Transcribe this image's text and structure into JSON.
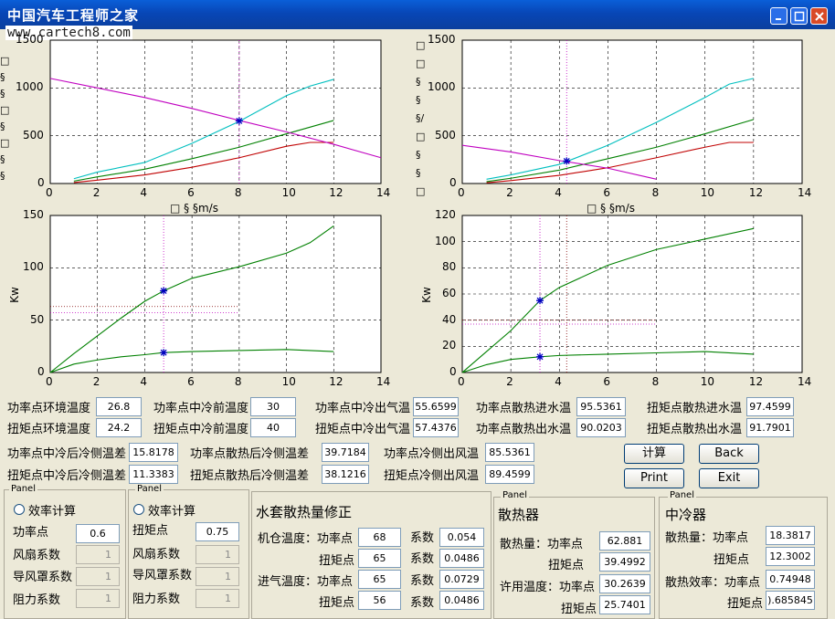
{
  "app": {
    "watermark": "www.cartech8.com",
    "logo_text": "中国汽车工程师之家"
  },
  "plots": [
    {
      "id": "tl",
      "xticks": [
        "0",
        "2",
        "4",
        "6",
        "8",
        "10",
        "12",
        "14"
      ],
      "yticks": [
        "0",
        "500",
        "1000",
        "1500"
      ],
      "xlim": [
        0,
        14
      ],
      "ylim": [
        0,
        1500
      ],
      "xlabel": "□ § §m/s",
      "ylabel": "",
      "series": [
        {
          "color": "#00bfbf",
          "x": [
            1,
            2,
            4,
            6,
            8,
            10,
            11,
            12
          ],
          "y": [
            50,
            120,
            220,
            420,
            650,
            920,
            1020,
            1090
          ]
        },
        {
          "color": "#008000",
          "x": [
            1,
            2,
            4,
            6,
            8,
            10,
            12
          ],
          "y": [
            25,
            70,
            150,
            260,
            380,
            520,
            660
          ]
        },
        {
          "color": "#c00000",
          "x": [
            1,
            2,
            4,
            6,
            8,
            10,
            11,
            12
          ],
          "y": [
            10,
            35,
            90,
            170,
            270,
            390,
            430,
            430
          ]
        },
        {
          "color": "#c000c0",
          "x": [
            0,
            2,
            4,
            6,
            8,
            10,
            12,
            14
          ],
          "y": [
            1100,
            1000,
            900,
            785,
            660,
            540,
            410,
            270
          ]
        }
      ],
      "marker": {
        "x": 8,
        "y": 655
      },
      "vline": 8
    },
    {
      "id": "tr",
      "xticks": [
        "0",
        "2",
        "4",
        "6",
        "8",
        "10",
        "12",
        "14"
      ],
      "yticks": [
        "0",
        "500",
        "1000",
        "1500"
      ],
      "xlim": [
        0,
        14
      ],
      "ylim": [
        0,
        1500
      ],
      "xlabel": "□ § §m/s",
      "ylabel": "",
      "series": [
        {
          "color": "#00bfbf",
          "x": [
            1,
            2,
            4,
            6,
            8,
            10,
            11,
            12
          ],
          "y": [
            45,
            90,
            200,
            400,
            640,
            900,
            1040,
            1100
          ]
        },
        {
          "color": "#008000",
          "x": [
            1,
            2,
            4,
            6,
            8,
            10,
            12
          ],
          "y": [
            20,
            55,
            140,
            260,
            380,
            520,
            670
          ]
        },
        {
          "color": "#c00000",
          "x": [
            1,
            2,
            4,
            6,
            8,
            10,
            11,
            12
          ],
          "y": [
            8,
            30,
            85,
            165,
            270,
            380,
            430,
            430
          ]
        },
        {
          "color": "#c000c0",
          "x": [
            0,
            2,
            4,
            6,
            8
          ],
          "y": [
            400,
            330,
            240,
            160,
            45
          ]
        }
      ],
      "marker": {
        "x": 4.3,
        "y": 235
      },
      "vline": 4.3
    },
    {
      "id": "bl",
      "xticks": [
        "0",
        "2",
        "4",
        "6",
        "8",
        "10",
        "12",
        "14"
      ],
      "yticks": [
        "0",
        "50",
        "100",
        "150"
      ],
      "xlim": [
        0,
        14
      ],
      "ylim": [
        0,
        150
      ],
      "xlabel": "",
      "ylabel": "Kw",
      "series": [
        {
          "color": "#008000",
          "x": [
            0,
            1,
            2,
            3,
            4,
            4.8,
            6,
            8,
            10,
            11,
            12
          ],
          "y": [
            0,
            18,
            35,
            52,
            68,
            78,
            90,
            101,
            114,
            124,
            140
          ]
        },
        {
          "color": "#008000",
          "x": [
            0,
            1,
            2,
            3,
            4,
            4.8,
            6,
            8,
            10,
            12
          ],
          "y": [
            0,
            8,
            12,
            15,
            17,
            19,
            20,
            21,
            22,
            20
          ]
        }
      ],
      "markers": [
        {
          "x": 4.8,
          "y": 78
        },
        {
          "x": 4.8,
          "y": 19
        }
      ],
      "vline": 4.8,
      "hlines": [
        63,
        57
      ]
    },
    {
      "id": "br",
      "xticks": [
        "0",
        "2",
        "4",
        "6",
        "8",
        "10",
        "12",
        "14"
      ],
      "yticks": [
        "0",
        "20",
        "40",
        "60",
        "80",
        "100",
        "120"
      ],
      "xlim": [
        0,
        14
      ],
      "ylim": [
        0,
        120
      ],
      "xlabel": "",
      "ylabel": "Kw",
      "series": [
        {
          "color": "#008000",
          "x": [
            0,
            1,
            2,
            3.2,
            4,
            6,
            8,
            10,
            12
          ],
          "y": [
            0,
            16,
            32,
            55,
            65,
            82,
            94,
            102,
            110
          ]
        },
        {
          "color": "#008000",
          "x": [
            0,
            1,
            2,
            3.2,
            4,
            6,
            8,
            10,
            12
          ],
          "y": [
            0,
            6,
            10,
            12,
            13,
            14,
            15,
            16,
            14
          ]
        }
      ],
      "markers": [
        {
          "x": 3.2,
          "y": 55
        },
        {
          "x": 3.2,
          "y": 12
        }
      ],
      "vline": 3.2,
      "vline2": 4.3,
      "hlines": [
        40,
        37
      ]
    }
  ],
  "row1": [
    {
      "label": "功率点环境温度",
      "value": "26.8"
    },
    {
      "label": "功率点中冷前温度",
      "value": "30"
    },
    {
      "label": "功率点中冷出气温",
      "value": "55.6599"
    },
    {
      "label": "功率点散热进水温",
      "value": "95.5361"
    },
    {
      "label": "扭矩点散热进水温",
      "value": "97.4599"
    }
  ],
  "row2": [
    {
      "label": "扭矩点环境温度",
      "value": "24.2"
    },
    {
      "label": "扭矩点中冷前温度",
      "value": "40"
    },
    {
      "label": "扭矩点中冷出气温",
      "value": "57.4376"
    },
    {
      "label": "功率点散热出水温",
      "value": "90.0203"
    },
    {
      "label": "扭矩点散热出水温",
      "value": "91.7901"
    }
  ],
  "row3": [
    {
      "label": "功率点中冷后冷侧温差",
      "value": "15.8178"
    },
    {
      "label": "功率点散热后冷侧温差",
      "value": "39.7184"
    },
    {
      "label": "功率点冷侧出风温",
      "value": "85.5361"
    }
  ],
  "row4": [
    {
      "label": "扭矩点中冷后冷侧温差",
      "value": "11.3383"
    },
    {
      "label": "扭矩点散热后冷侧温差",
      "value": "38.1216"
    },
    {
      "label": "扭矩点冷侧出风温",
      "value": "89.4599"
    }
  ],
  "buttons": {
    "calc": "计算",
    "back": "Back",
    "print": "Print",
    "exit": "Exit"
  },
  "panel1": {
    "title": "Panel",
    "radio": "效率计算",
    "point": "功率点",
    "point_value": "0.6",
    "fan": "风扇系数",
    "fan_value": "1",
    "duct": "导风罩系数",
    "duct_value": "1",
    "resist": "阻力系数",
    "resist_value": "1"
  },
  "panel2": {
    "title": "Panel",
    "radio": "效率计算",
    "point": "扭矩点",
    "point_value": "0.75",
    "fan": "风扇系数",
    "fan_value": "1",
    "duct": "导风罩系数",
    "duct_value": "1",
    "resist": "阻力系数",
    "resist_value": "1"
  },
  "panel3": {
    "title": "水套散热量修正",
    "r1_label": "机仓温度：功率点",
    "r1_value": "68",
    "r1_coef_label": "系数",
    "r1_coef": "0.054",
    "r2_label": "扭矩点",
    "r2_value": "65",
    "r2_coef_label": "系数",
    "r2_coef": "0.0486",
    "r3_label": "进气温度：功率点",
    "r3_value": "65",
    "r3_coef_label": "系数",
    "r3_coef": "0.0729",
    "r4_label": "扭矩点",
    "r4_value": "56",
    "r4_coef_label": "系数",
    "r4_coef": "0.0486"
  },
  "panel4": {
    "ptitle": "Panel",
    "title": "散热器",
    "r1_label": "散热量：功率点",
    "r1_value": "62.881",
    "r2_label": "扭矩点",
    "r2_value": "39.4992",
    "r3_label": "许用温度：功率点",
    "r3_value": "30.2639",
    "r4_label": "扭矩点",
    "r4_value": "25.7401"
  },
  "panel5": {
    "ptitle": "Panel",
    "title": "中冷器",
    "r1_label": "散热量：功率点",
    "r1_value": "18.3817",
    "r2_label": "扭矩点",
    "r2_value": "12.3002",
    "r3_label": "散热效率：功率点",
    "r3_value": "0.74948",
    "r4_label": "扭矩点",
    "r4_value": ").685845"
  }
}
